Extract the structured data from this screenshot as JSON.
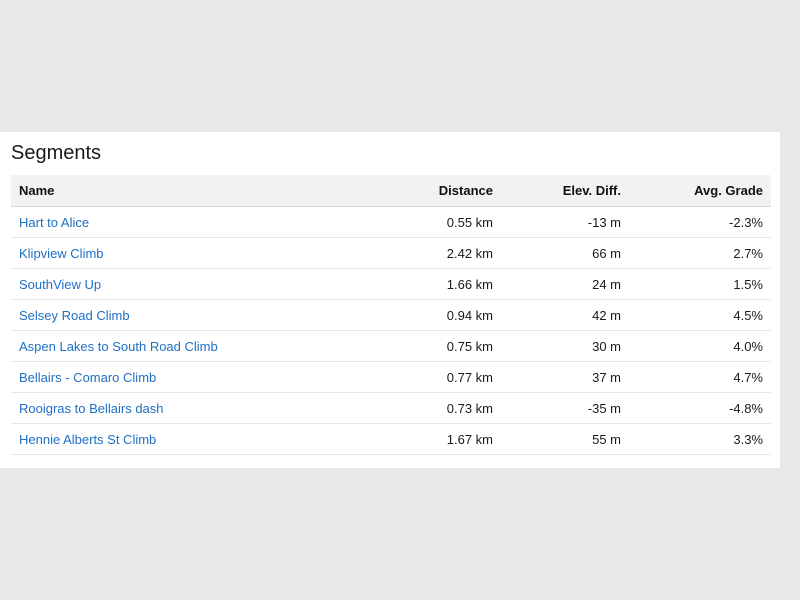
{
  "section": {
    "title": "Segments"
  },
  "table": {
    "headers": {
      "name": "Name",
      "distance": "Distance",
      "elev_diff": "Elev. Diff.",
      "avg_grade": "Avg. Grade"
    },
    "rows": [
      {
        "name": "Hart to Alice",
        "distance": "0.55 km",
        "elev_diff": "-13 m",
        "avg_grade": "-2.3%"
      },
      {
        "name": "Klipview Climb",
        "distance": "2.42 km",
        "elev_diff": "66 m",
        "avg_grade": "2.7%"
      },
      {
        "name": "SouthView Up",
        "distance": "1.66 km",
        "elev_diff": "24 m",
        "avg_grade": "1.5%"
      },
      {
        "name": "Selsey Road Climb",
        "distance": "0.94 km",
        "elev_diff": "42 m",
        "avg_grade": "4.5%"
      },
      {
        "name": "Aspen Lakes to South Road Climb",
        "distance": "0.75 km",
        "elev_diff": "30 m",
        "avg_grade": "4.0%"
      },
      {
        "name": "Bellairs - Comaro Climb",
        "distance": "0.77 km",
        "elev_diff": "37 m",
        "avg_grade": "4.7%"
      },
      {
        "name": "Rooigras to Bellairs dash",
        "distance": "0.73 km",
        "elev_diff": "-35 m",
        "avg_grade": "-4.8%"
      },
      {
        "name": "Hennie Alberts St Climb",
        "distance": "1.67 km",
        "elev_diff": "55 m",
        "avg_grade": "3.3%"
      }
    ]
  },
  "colors": {
    "link": "#1f6fc5",
    "header_bg": "#f2f2f2",
    "page_bg": "#e8e8e8"
  }
}
